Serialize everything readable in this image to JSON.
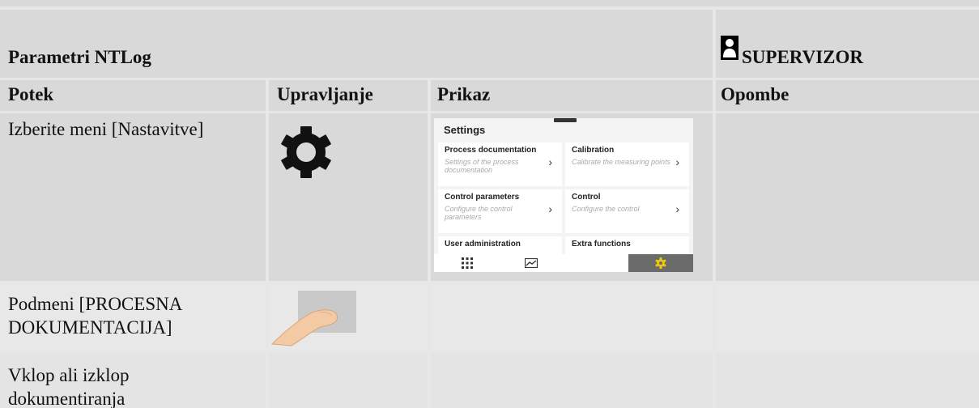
{
  "header": {
    "title": "Parametri NTLog",
    "role": "SUPERVIZOR"
  },
  "columns": [
    "Potek",
    "Upravljanje",
    "Prikaz",
    "Opombe"
  ],
  "rows": [
    {
      "step": "Izberite meni [Nastavitve]"
    },
    {
      "step": "Podmeni [PROCESNA DOKUMENTACIJA]"
    },
    {
      "step": "Vklop ali izklop dokumentiranja"
    }
  ],
  "settings_screen": {
    "title": "Settings",
    "tiles": [
      {
        "title": "Process documentation",
        "subtitle": "Settings of the process documentation",
        "chevron": "›"
      },
      {
        "title": "Calibration",
        "subtitle": "Calibrate the measuring points",
        "chevron": "›"
      },
      {
        "title": "Control parameters",
        "subtitle": "Configure the control parameters",
        "chevron": "›"
      },
      {
        "title": "Control",
        "subtitle": "Configure the control",
        "chevron": "›"
      },
      {
        "title": "User administration",
        "subtitle": "",
        "chevron": ""
      },
      {
        "title": "Extra functions",
        "subtitle": "",
        "chevron": ""
      }
    ],
    "nav_icons": [
      "grid-icon",
      "chart-icon",
      "gear-icon"
    ],
    "accent": "#f2c80f"
  },
  "colors": {
    "cell": "#d9d9d9",
    "grid": "#e7e7e7",
    "nav_active": "#6b6b6b"
  }
}
